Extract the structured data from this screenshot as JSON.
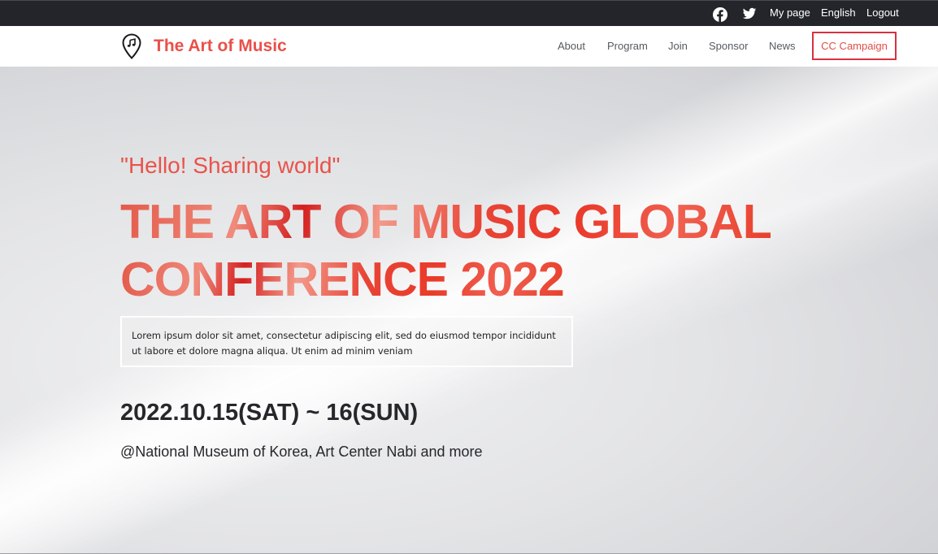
{
  "topbar": {
    "icons": [
      "facebook-icon",
      "twitter-icon"
    ],
    "links": {
      "my_page": "My page",
      "language": "English",
      "logout": "Logout"
    }
  },
  "nav": {
    "site_title": "The Art of Music",
    "logo_icon": "music-map-pin-icon",
    "items": {
      "about": "About",
      "program": "Program",
      "join": "Join",
      "sponsor": "Sponsor",
      "news": "News",
      "cc_campaign": "CC Campaign"
    }
  },
  "hero": {
    "tagline": "\"Hello! Sharing world\"",
    "headline_line1": "THE ART OF MUSIC GLOBAL",
    "headline_line2": "CONFERENCE 2022",
    "description": "Lorem ipsum dolor sit amet, consectetur adipiscing elit, sed do eiusmod tempor incididunt ut labore et dolore magna aliqua. Ut enim ad minim veniam",
    "date": "2022.10.15(SAT) ~ 16(SUN)",
    "venue": "@National Museum of Korea, Art Center Nabi and more"
  },
  "colors": {
    "accent": "#e9504a",
    "topbar_bg": "#23252b",
    "highlight_border": "#d9313f",
    "dark_text": "#25272b"
  }
}
